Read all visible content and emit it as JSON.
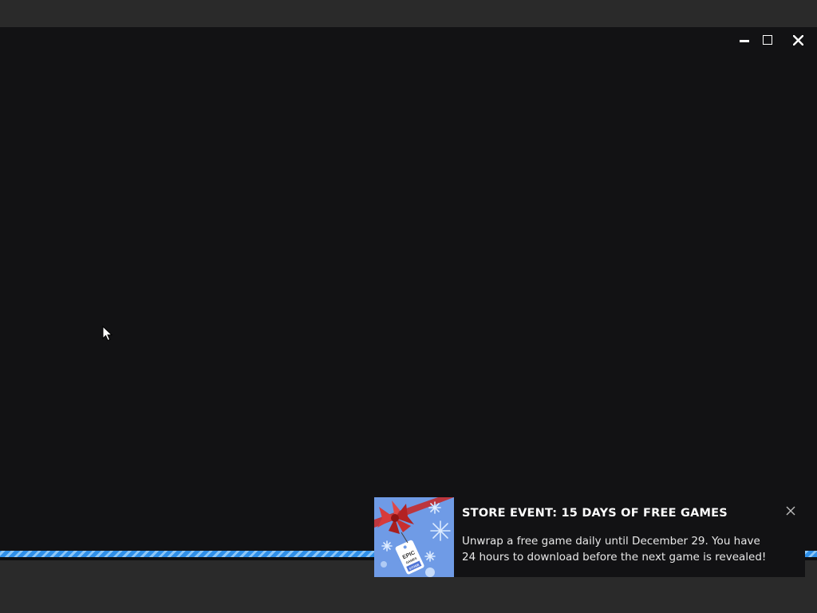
{
  "window_controls": {
    "minimize": "minimize",
    "maximize": "maximize",
    "close": "close"
  },
  "notification": {
    "title": "STORE EVENT: 15 DAYS OF FREE GAMES",
    "body": "Unwrap a free game daily until December 29. You have 24 hours to download before the next game is revealed!",
    "image_icon": "epic-games-store-gift-tag-image",
    "art_text": {
      "line1": "EPIC",
      "line2": "GAMES",
      "line3": "STORE"
    },
    "close_icon": "close-icon"
  },
  "colors": {
    "window_bg": "#121214",
    "chrome_bg": "#2a2a2a",
    "progress_stripe_dark": "#2f8fe8",
    "progress_stripe_light": "#8cc6f6",
    "art_bg": "#6f9be6",
    "bow_red": "#c42b2b"
  }
}
